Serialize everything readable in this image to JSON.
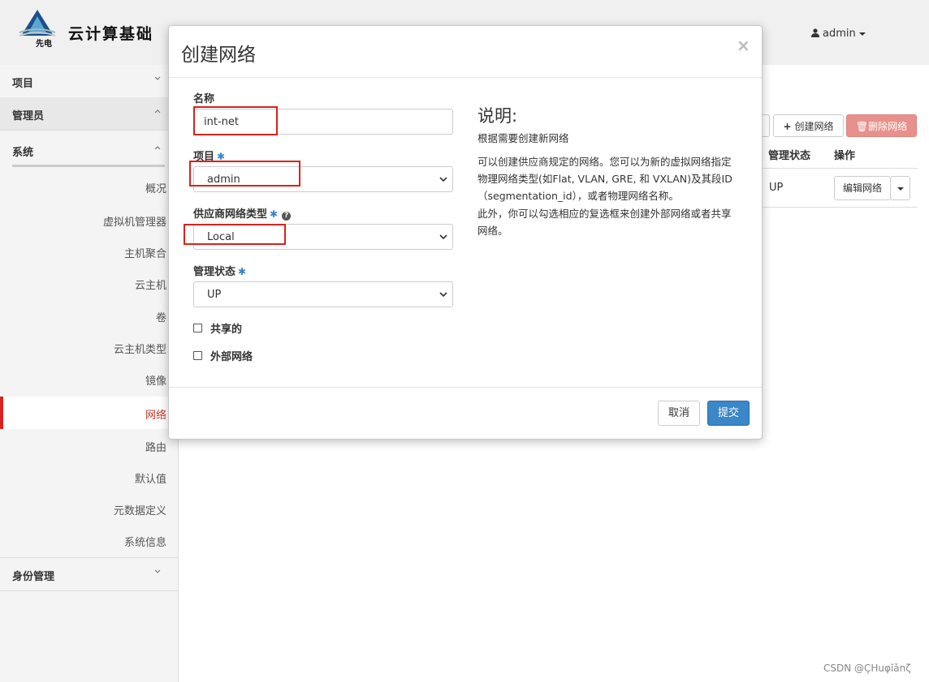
{
  "header": {
    "brand": "云计算基础",
    "logo_text": "先电",
    "user": "admin"
  },
  "sidebar": {
    "sections": [
      {
        "label": "项目"
      },
      {
        "label": "管理员"
      },
      {
        "label": "系统"
      },
      {
        "label": "身份管理"
      }
    ],
    "items": [
      {
        "label": "概况"
      },
      {
        "label": "虚拟机管理器"
      },
      {
        "label": "主机聚合"
      },
      {
        "label": "云主机"
      },
      {
        "label": "卷"
      },
      {
        "label": "云主机类型"
      },
      {
        "label": "镜像"
      },
      {
        "label": "网络"
      },
      {
        "label": "路由"
      },
      {
        "label": "默认值"
      },
      {
        "label": "元数据定义"
      },
      {
        "label": "系统信息"
      }
    ],
    "active_item": "网络"
  },
  "page": {
    "create_network_button": "创建网络",
    "delete_network_button": "删除网络",
    "columns": [
      "管理状态",
      "操作"
    ],
    "row": {
      "admin_state": "UP",
      "action": "编辑网络"
    }
  },
  "modal": {
    "title": "创建网络",
    "close": "×",
    "fields": {
      "name": {
        "label": "名称",
        "value": "int-net"
      },
      "project": {
        "label": "项目",
        "value": "admin"
      },
      "provider_type": {
        "label": "供应商网络类型",
        "value": "Local"
      },
      "admin_state": {
        "label": "管理状态",
        "value": "UP"
      }
    },
    "checkboxes": [
      {
        "label": "共享的",
        "checked": false
      },
      {
        "label": "外部网络",
        "checked": false
      }
    ],
    "description": {
      "title": "说明:",
      "p1": "根据需要创建新网络",
      "p2": "可以创建供应商规定的网络。您可以为新的虚拟网络指定物理网络类型(如Flat, VLAN, GRE, 和 VXLAN)及其段ID（segmentation_id），或者物理网络名称。",
      "p3": "此外，你可以勾选相应的复选框来创建外部网络或者共享网络。"
    },
    "cancel_button": "取消",
    "submit_button": "提交"
  },
  "watermark": "CSDN @ÇHuφĭǎnζ",
  "colors": {
    "accent_red": "#d9241b",
    "primary_blue": "#3b87c8",
    "delete_red": "#e8908b"
  }
}
